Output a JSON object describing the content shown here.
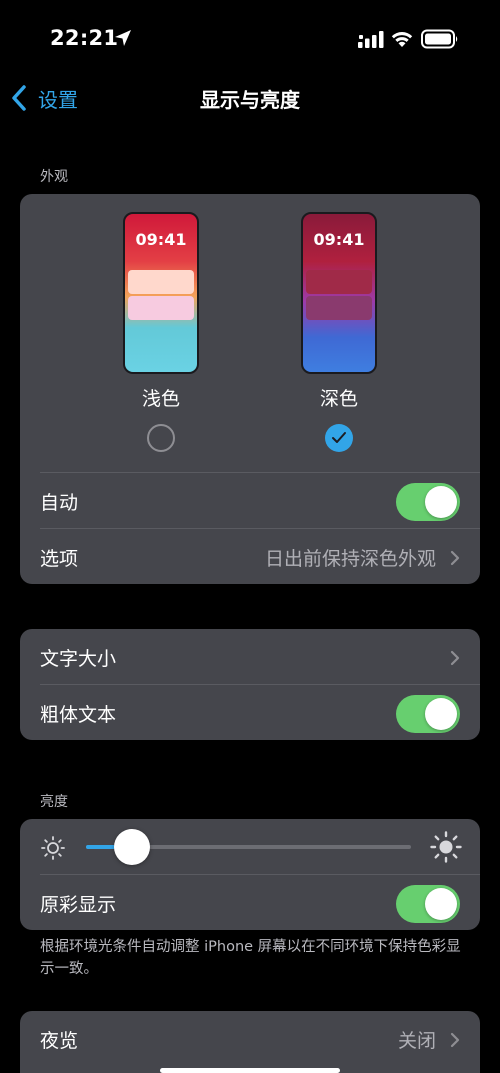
{
  "status_bar": {
    "time": "22:21",
    "icons": [
      "location-icon",
      "signal-icon",
      "wifi-icon",
      "battery-icon"
    ]
  },
  "nav": {
    "back_label": "设置",
    "title": "显示与亮度"
  },
  "appearance": {
    "header": "外观",
    "light": {
      "label": "浅色",
      "preview_time": "09:41",
      "selected": false
    },
    "dark": {
      "label": "深色",
      "preview_time": "09:41",
      "selected": true
    },
    "auto": {
      "label": "自动",
      "on": true
    },
    "options": {
      "label": "选项",
      "value": "日出前保持深色外观"
    }
  },
  "text": {
    "text_size_label": "文字大小",
    "bold_text": {
      "label": "粗体文本",
      "on": true
    }
  },
  "brightness": {
    "header": "亮度",
    "level": 0.14,
    "true_tone": {
      "label": "原彩显示",
      "on": true
    },
    "footnote": "根据环境光条件自动调整 iPhone 屏幕以在不同环境下保持色彩显示一致。"
  },
  "night_shift": {
    "label": "夜览",
    "value": "关闭"
  },
  "colors": {
    "accent": "#32a5e8",
    "toggle_on": "#67cf6f",
    "card_bg": "#45464c",
    "background": "#000000"
  }
}
